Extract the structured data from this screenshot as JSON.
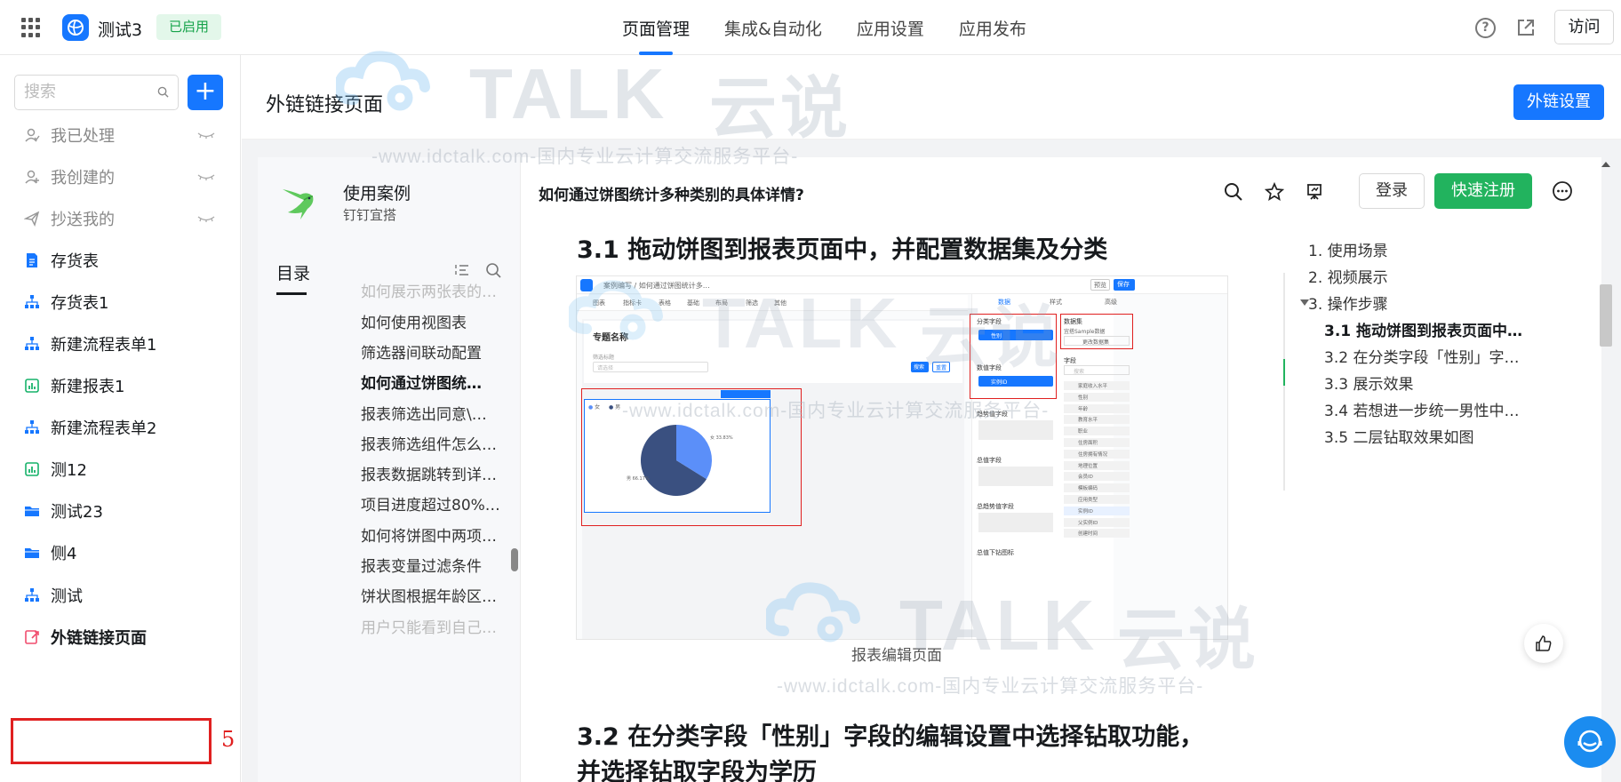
{
  "topbar": {
    "app_name": "测试3",
    "status": "已启用",
    "tabs": [
      "页面管理",
      "集成&自动化",
      "应用设置",
      "应用发布"
    ],
    "visit_label": "访问"
  },
  "sidebar": {
    "search_placeholder": "搜索",
    "add_label": "+",
    "items": [
      {
        "label": "我已处理",
        "icon": "user-check-icon"
      },
      {
        "label": "我创建的",
        "icon": "user-add-icon"
      },
      {
        "label": "抄送我的",
        "icon": "send-icon"
      },
      {
        "label": "存货表",
        "icon": "form-icon"
      },
      {
        "label": "存货表1",
        "icon": "flow-icon"
      },
      {
        "label": "新建流程表单1",
        "icon": "flow-icon"
      },
      {
        "label": "新建报表1",
        "icon": "report-icon"
      },
      {
        "label": "新建流程表单2",
        "icon": "flow-icon"
      },
      {
        "label": "测12",
        "icon": "report-icon"
      },
      {
        "label": "测试23",
        "icon": "folder-icon"
      },
      {
        "label": "侧4",
        "icon": "folder-icon"
      },
      {
        "label": "测试",
        "icon": "flow-icon"
      },
      {
        "label": "外链链接页面",
        "icon": "link-page-icon"
      }
    ],
    "annotation": "5"
  },
  "header": {
    "title": "外链链接页面",
    "settings_label": "外链设置"
  },
  "doc_sidebar": {
    "title": "使用案例",
    "subtitle": "钉钉宜搭",
    "toc_label": "目录",
    "items": [
      "如何展示两张表的…",
      "如何使用视图表",
      "筛选器间联动配置",
      "如何通过饼图统…",
      "报表筛选出同意\\…",
      "报表筛选组件怎么…",
      "报表数据跳转到详…",
      "项目进度超过80%…",
      "如何将饼图中两项…",
      "报表变量过滤条件",
      "饼状图根据年龄区…",
      "用户只能看到自己…"
    ],
    "active_index": 3
  },
  "doc": {
    "question": "如何通过饼图统计多种类别的具体详情?",
    "login_label": "登录",
    "register_label": "快速注册",
    "heading_31": "3.1 拖动饼图到报表页面中，并配置数据集及分类",
    "caption": "报表编辑页面",
    "heading_32": "3.2 在分类字段「性别」字段的编辑设置中选择钻取功能，并选择钻取字段为学历"
  },
  "outline": {
    "items": [
      "1. 使用场景",
      "2. 视频展示",
      "3. 操作步骤",
      "3.1 拖动饼图到报表页面中，并…",
      "3.2 在分类字段「性别」字段的编…",
      "3.3 展示效果",
      "3.4 若想进一步统一男性中硕士学…",
      "3.5 二层钻取效果如图"
    ]
  },
  "watermark": {
    "brand": "TALK",
    "brand_cn": "云说",
    "line": "-www.idctalk.com-国内专业云计算交流服务平台-"
  },
  "mock": {
    "breadcrumb": "案例编写 / 如何通过饼图统计多…",
    "toolbar": [
      "图表",
      "指标卡",
      "表格",
      "基础",
      "布局",
      "筛选",
      "其他"
    ],
    "panel_tabs": [
      "数据",
      "样式",
      "高级"
    ],
    "section_title": "专题名称",
    "filter_label": "筛选标题",
    "filter_placeholder": "请选择",
    "search_btn": "搜索",
    "reset_btn": "重置",
    "legend": [
      "女",
      "男"
    ],
    "pie_labels": [
      "女 33.83%",
      "男 66.17%"
    ],
    "pie_values": [
      33.83,
      66.17
    ],
    "fields": [
      "分类字段",
      "数值字段",
      "趋势值字段",
      "总值字段",
      "总趋势值字段",
      "总值下钻图标"
    ],
    "field_tags": [
      "性别",
      "实例ID"
    ],
    "dataset_title": "数据集",
    "dataset_name": "宜搭Sample数据",
    "dataset_btn": "更改数据集",
    "field_list_title": "字段",
    "field_list_placeholder": "搜索",
    "field_list": [
      "家庭收入水平",
      "性别",
      "年龄",
      "教育水平",
      "职业",
      "住房面积",
      "住房拥有情况",
      "地理位置",
      "会员ID",
      "模板编码",
      "应用类型",
      "实例ID",
      "父实例ID",
      "创建时间"
    ],
    "buttons": [
      "预览",
      "保存"
    ]
  },
  "colors": {
    "primary": "#1677ff",
    "success": "#22b35e",
    "annotation": "#e02020",
    "pie_female": "#5b8ff9",
    "pie_male": "#3a5080"
  }
}
